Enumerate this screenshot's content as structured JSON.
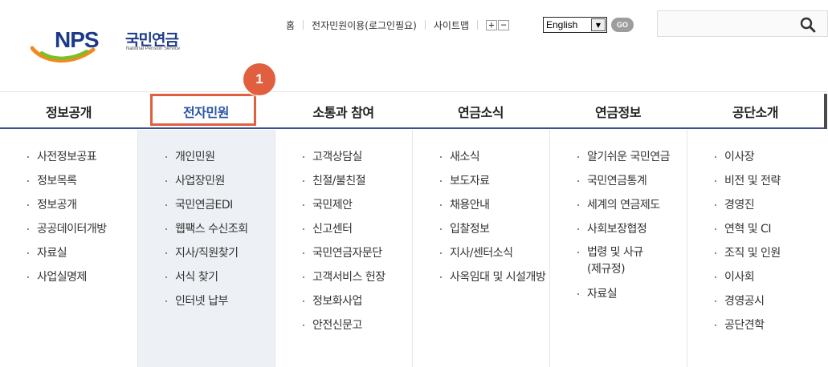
{
  "logo": {
    "mark": "NPS",
    "name_kr": "국민연금",
    "name_en": "National Pension Service"
  },
  "util": {
    "home": "홈",
    "civil_service": "전자민원이용(로그인필요)",
    "sitemap": "사이트맵",
    "zoom_in": "+",
    "zoom_out": "−"
  },
  "language": {
    "selected": "English",
    "go_label": "GO"
  },
  "search": {
    "placeholder": ""
  },
  "step_badge": "1",
  "gnb": {
    "active_index": 1,
    "items": [
      {
        "label": "정보공개",
        "sub": [
          "사전정보공표",
          "정보목록",
          "정보공개",
          "공공데이터개방",
          "자료실",
          "사업실명제"
        ]
      },
      {
        "label": "전자민원",
        "sub": [
          "개인민원",
          "사업장민원",
          "국민연금EDI",
          "웹팩스 수신조회",
          "지사/직원찾기",
          "서식 찾기",
          "인터넷 납부"
        ]
      },
      {
        "label": "소통과 참여",
        "sub": [
          "고객상담실",
          "친절/불친절",
          "국민제안",
          "신고센터",
          "국민연금자문단",
          "고객서비스 헌장",
          "정보화사업",
          "안전신문고"
        ]
      },
      {
        "label": "연금소식",
        "sub": [
          "새소식",
          "보도자료",
          "채용안내",
          "입찰정보",
          "지사/센터소식",
          "사옥임대 및 시설개방"
        ]
      },
      {
        "label": "연금정보",
        "sub": [
          "알기쉬운 국민연금",
          "국민연금통계",
          "세계의 연금제도",
          "사회보장협정",
          "법령 및 사규(제규정)",
          "자료실"
        ]
      },
      {
        "label": "공단소개",
        "sub": [
          "이사장",
          "비전 및 전략",
          "경영진",
          "연혁 및 CI",
          "조직 및 인원",
          "이사회",
          "경영공시",
          "공단견학"
        ]
      }
    ]
  },
  "colors": {
    "brand_navy": "#1d3a8a",
    "active_blue": "#2954a6",
    "highlight": "#e05f3f",
    "active_bg": "#edf1f5"
  }
}
